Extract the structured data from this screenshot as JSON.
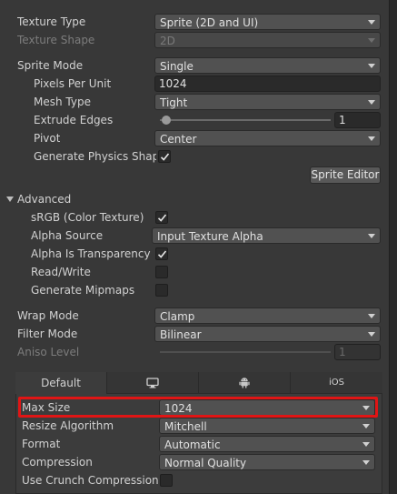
{
  "texture": {
    "texture_type_label": "Texture Type",
    "texture_type_value": "Sprite (2D and UI)",
    "texture_shape_label": "Texture Shape",
    "texture_shape_value": "2D"
  },
  "sprite": {
    "mode_label": "Sprite Mode",
    "mode_value": "Single",
    "ppu_label": "Pixels Per Unit",
    "ppu_value": "1024",
    "mesh_type_label": "Mesh Type",
    "mesh_type_value": "Tight",
    "extrude_label": "Extrude Edges",
    "extrude_value": "1",
    "pivot_label": "Pivot",
    "pivot_value": "Center",
    "physics_label": "Generate Physics Shape",
    "editor_button": "Sprite Editor"
  },
  "advanced": {
    "header": "Advanced",
    "srgb_label": "sRGB (Color Texture)",
    "alpha_source_label": "Alpha Source",
    "alpha_source_value": "Input Texture Alpha",
    "alpha_transparency_label": "Alpha Is Transparency",
    "readwrite_label": "Read/Write",
    "mipmaps_label": "Generate Mipmaps"
  },
  "wrap": {
    "wrap_label": "Wrap Mode",
    "wrap_value": "Clamp",
    "filter_label": "Filter Mode",
    "filter_value": "Bilinear",
    "aniso_label": "Aniso Level",
    "aniso_value": "1"
  },
  "platform": {
    "tabs": [
      "Default",
      "monitor-icon",
      "android-icon",
      "iOS"
    ],
    "max_size_label": "Max Size",
    "max_size_value": "1024",
    "resize_label": "Resize Algorithm",
    "resize_value": "Mitchell",
    "format_label": "Format",
    "format_value": "Automatic",
    "compression_label": "Compression",
    "compression_value": "Normal Quality",
    "crunch_label": "Use Crunch Compression"
  },
  "colors": {
    "highlight": "#e01515",
    "background": "#383838"
  }
}
